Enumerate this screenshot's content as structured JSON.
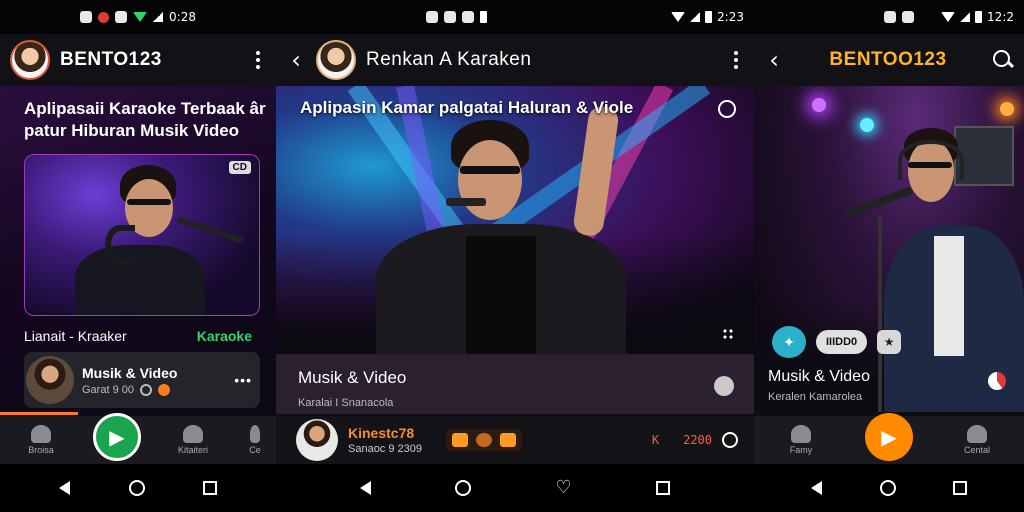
{
  "colors": {
    "accent_orange": "#ff8a00",
    "accent_green": "#1ba44e",
    "highlight_green": "#35d46a",
    "title_orange": "#ffb428"
  },
  "screen1": {
    "status": {
      "time": "0:28"
    },
    "appbar": {
      "title": "BENTO123"
    },
    "headline": "Aplipasaii Karaoke Terbaak âr patur Hiburan Musik Video",
    "card_badge": "CD",
    "row": {
      "left": "Lianait - Kraaker",
      "right": "Karaoke"
    },
    "item": {
      "title": "Musik & Video",
      "subtitle": "Garat 9 00"
    },
    "nav": {
      "tab1": "Broisa",
      "tab2": "Kitaiteri",
      "tab3": "Ce"
    }
  },
  "screen2": {
    "status": {
      "time": "2:23"
    },
    "appbar": {
      "title": "Renkan A Karaken"
    },
    "headline": "Aplipasin Kamar palgatai Haluran & Viole",
    "info": {
      "title": "Musik & Video",
      "subtitle": "Karalai I Snanacola"
    },
    "player": {
      "title": "Kinestc78",
      "subtitle": "Sanaoc 9 2309",
      "badge": "K",
      "time": "2200"
    }
  },
  "screen3": {
    "status": {
      "time": "12:2"
    },
    "appbar": {
      "title": "BENTOO123"
    },
    "tag_pill": "IIIDD0",
    "title": "Musik & Video",
    "subtitle": "Keralen Kamarolea",
    "nav": {
      "tab1": "Famy",
      "tab2": "Cental"
    }
  }
}
